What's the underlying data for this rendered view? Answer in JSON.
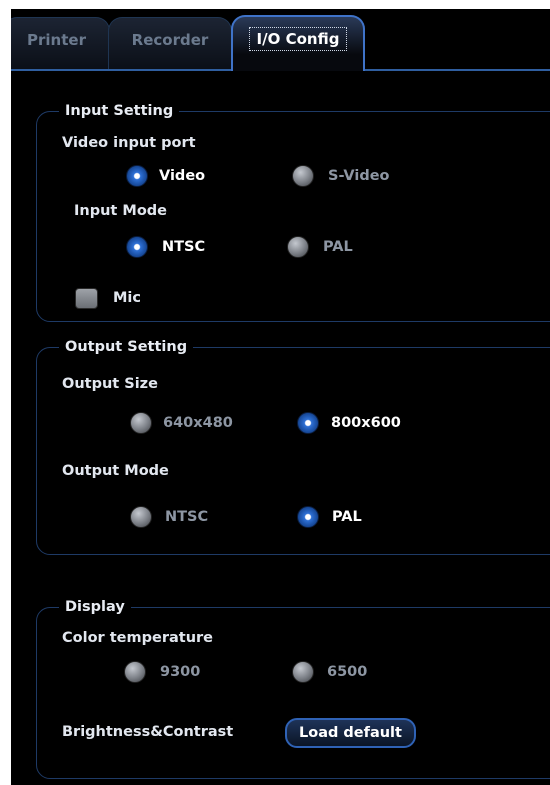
{
  "tabs": [
    {
      "label": "Printer",
      "active": false
    },
    {
      "label": "Recorder",
      "active": false
    },
    {
      "label": "I/O Config",
      "active": true
    }
  ],
  "input_setting": {
    "legend": "Input Setting",
    "video_port": {
      "label": "Video input port",
      "options": [
        {
          "label": "Video",
          "selected": true
        },
        {
          "label": "S-Video",
          "selected": false
        }
      ]
    },
    "input_mode": {
      "label": "Input Mode",
      "options": [
        {
          "label": "NTSC",
          "selected": true
        },
        {
          "label": "PAL",
          "selected": false
        }
      ]
    },
    "mic": {
      "label": "Mic",
      "checked": false
    }
  },
  "output_setting": {
    "legend": "Output Setting",
    "output_size": {
      "label": "Output Size",
      "options": [
        {
          "label": "640x480",
          "selected": false
        },
        {
          "label": "800x600",
          "selected": true
        }
      ]
    },
    "output_mode": {
      "label": "Output Mode",
      "options": [
        {
          "label": "NTSC",
          "selected": false
        },
        {
          "label": "PAL",
          "selected": true
        }
      ]
    }
  },
  "display": {
    "legend": "Display",
    "color_temperature": {
      "label": "Color temperature",
      "options": [
        {
          "label": "9300",
          "selected": false
        },
        {
          "label": "6500",
          "selected": false
        }
      ]
    },
    "brightness_contrast": {
      "label": "Brightness&Contrast",
      "button_label": "Load default"
    }
  },
  "colors": {
    "accent_blue": "#2f71d6",
    "border_blue": "#1e3a66",
    "background": "#000000"
  }
}
